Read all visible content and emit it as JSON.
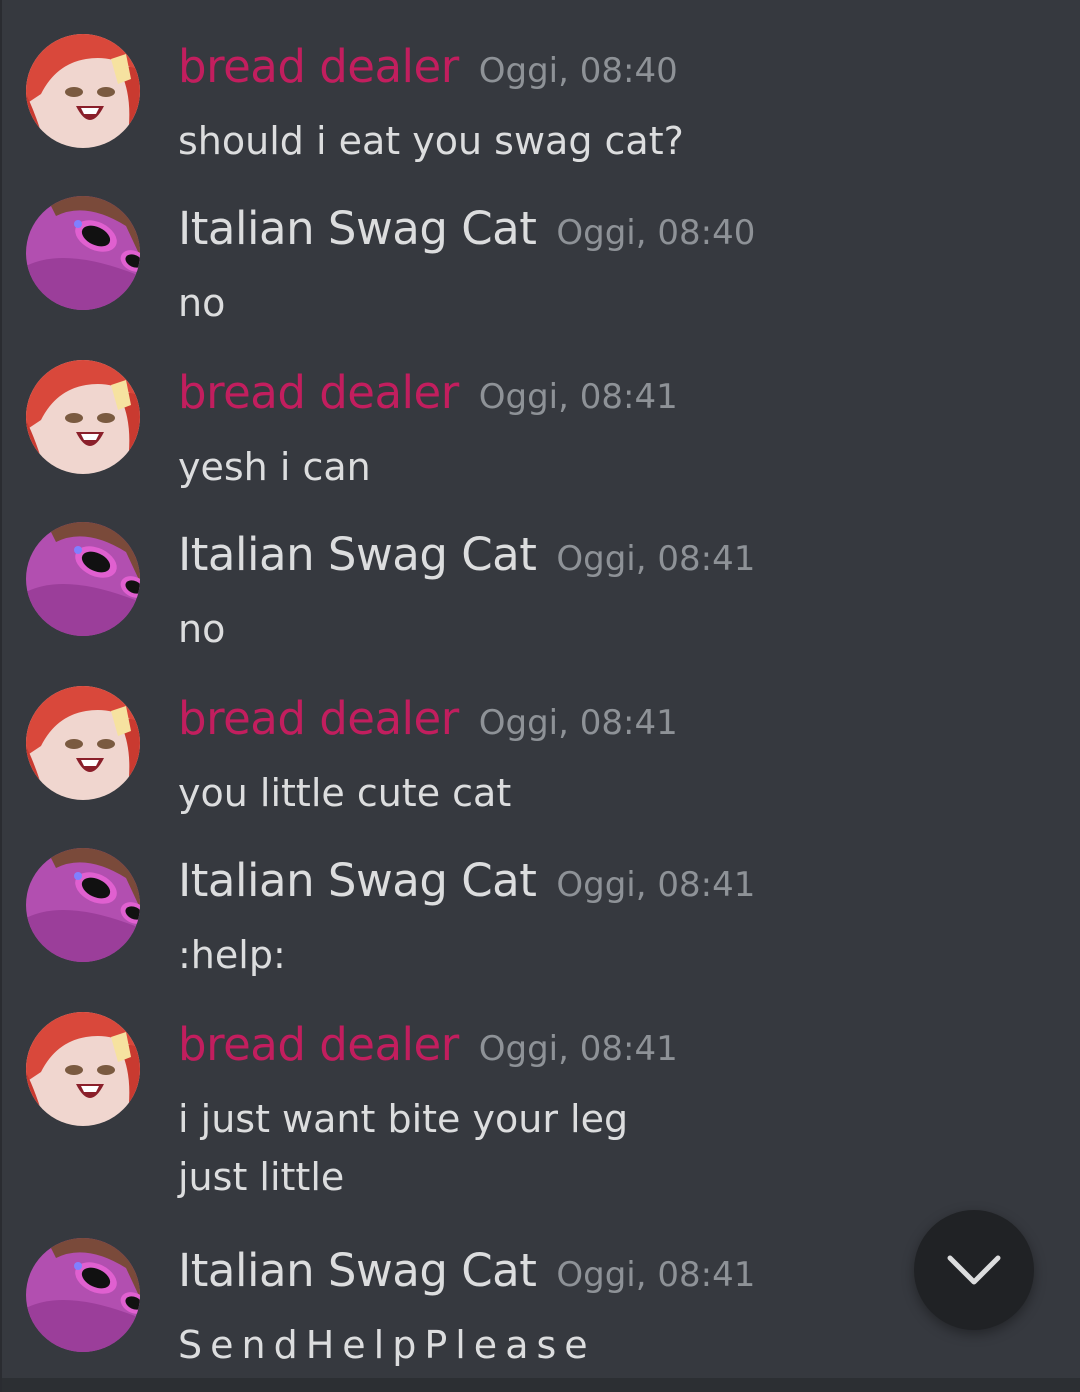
{
  "colors": {
    "background": "#36393f",
    "bread_dealer_name": "#c21e5e",
    "cat_name": "#dcddde",
    "timestamp": "#8e9297",
    "message_text": "#dcddde",
    "scroll_button": "#202225"
  },
  "messages": [
    {
      "author": "bread dealer",
      "author_role": "bread",
      "time": "Oggi, 08:40",
      "text": "should i eat you swag cat?"
    },
    {
      "author": "Italian Swag Cat",
      "author_role": "cat",
      "time": "Oggi, 08:40",
      "text": "no"
    },
    {
      "author": "bread dealer",
      "author_role": "bread",
      "time": "Oggi, 08:41",
      "text": "yesh i can"
    },
    {
      "author": "Italian Swag Cat",
      "author_role": "cat",
      "time": "Oggi, 08:41",
      "text": "no"
    },
    {
      "author": "bread dealer",
      "author_role": "bread",
      "time": "Oggi, 08:41",
      "text": "you little cute cat"
    },
    {
      "author": "Italian Swag Cat",
      "author_role": "cat",
      "time": "Oggi, 08:41",
      "text": ":help:"
    },
    {
      "author": "bread dealer",
      "author_role": "bread",
      "time": "Oggi, 08:41",
      "text": "i just want bite your leg\njust little"
    },
    {
      "author": "Italian Swag Cat",
      "author_role": "cat",
      "time": "Oggi, 08:41",
      "text": "SendHelpPlease"
    }
  ],
  "scroll_button_icon": "chevron-down-icon"
}
